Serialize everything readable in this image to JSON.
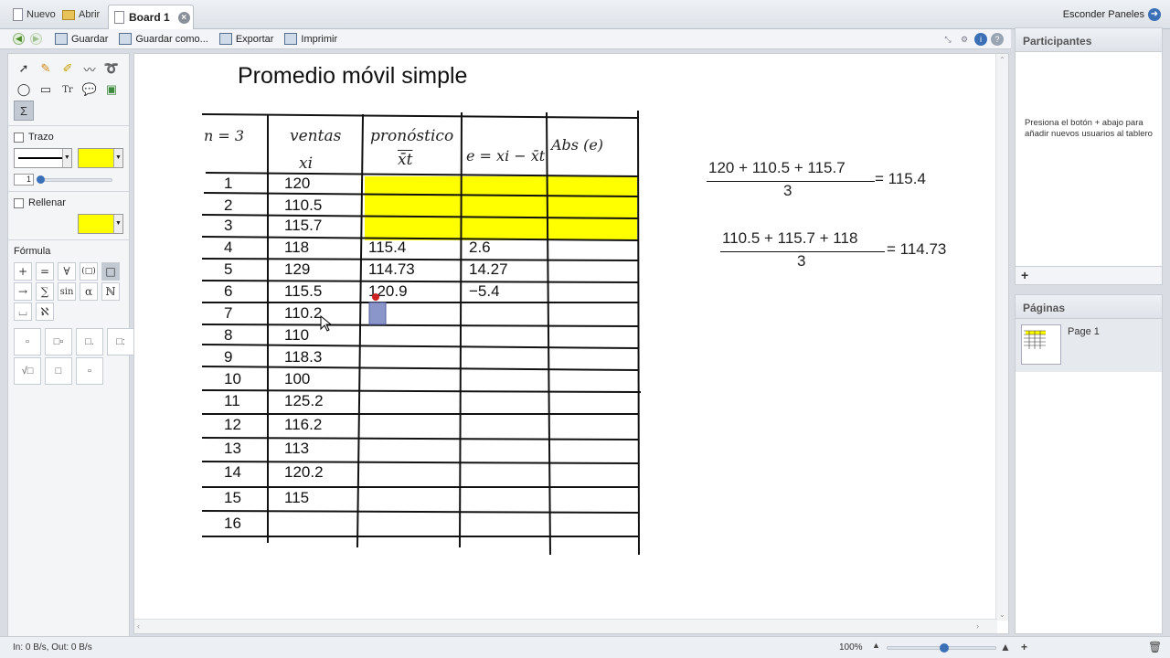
{
  "tabbar": {
    "new_label": "Nuevo",
    "open_label": "Abrir",
    "active_tab": "Board 1",
    "hide_panels": "Esconder Paneles"
  },
  "toolbar": {
    "save": "Guardar",
    "save_as": "Guardar como...",
    "export": "Exportar",
    "print": "Imprimir"
  },
  "left_panel": {
    "stroke_label": "Trazo",
    "stroke_width": "1",
    "stroke_color": "#ffff00",
    "fill_label": "Rellenar",
    "fill_color": "#ffff00",
    "formula_label": "Fórmula",
    "formula_buttons": [
      "+",
      "=",
      "∀",
      "(□)",
      "□",
      "→",
      "∑",
      "sin",
      "α",
      "ℕ",
      "⌴",
      "ℵ"
    ]
  },
  "canvas": {
    "title": "Promedio móvil simple",
    "headers": {
      "n": "n = 3",
      "sales_1": "ventas",
      "sales_2": "xi",
      "forecast_1": "pronóstico",
      "forecast_2": "x̄t",
      "error": "e = xi − x̄t",
      "abs": "Abs (e)"
    },
    "rows": [
      {
        "n": "1",
        "ventas": "120",
        "pronostico": "",
        "error": ""
      },
      {
        "n": "2",
        "ventas": "110.5",
        "pronostico": "",
        "error": ""
      },
      {
        "n": "3",
        "ventas": "115.7",
        "pronostico": "",
        "error": ""
      },
      {
        "n": "4",
        "ventas": "118",
        "pronostico": "115.4",
        "error": "2.6"
      },
      {
        "n": "5",
        "ventas": "129",
        "pronostico": "114.73",
        "error": "14.27"
      },
      {
        "n": "6",
        "ventas": "115.5",
        "pronostico": "120.9",
        "error": "−5.4"
      },
      {
        "n": "7",
        "ventas": "110.2",
        "pronostico": "",
        "error": ""
      },
      {
        "n": "8",
        "ventas": "110",
        "pronostico": "",
        "error": ""
      },
      {
        "n": "9",
        "ventas": "118.3",
        "pronostico": "",
        "error": ""
      },
      {
        "n": "10",
        "ventas": "100",
        "pronostico": "",
        "error": ""
      },
      {
        "n": "11",
        "ventas": "125.2",
        "pronostico": "",
        "error": ""
      },
      {
        "n": "12",
        "ventas": "116.2",
        "pronostico": "",
        "error": ""
      },
      {
        "n": "13",
        "ventas": "113",
        "pronostico": "",
        "error": ""
      },
      {
        "n": "14",
        "ventas": "120.2",
        "pronostico": "",
        "error": ""
      },
      {
        "n": "15",
        "ventas": "115",
        "pronostico": "",
        "error": ""
      },
      {
        "n": "16",
        "ventas": "",
        "pronostico": "",
        "error": ""
      }
    ],
    "equation1": {
      "numerator": "120 + 110.5 + 115.7",
      "denominator": "3",
      "result": "= 115.4"
    },
    "equation2": {
      "numerator": "110.5 + 115.7 + 118",
      "denominator": "3",
      "result": "= 114.73"
    },
    "highlight_color": "#ffff00"
  },
  "participants": {
    "title": "Participantes",
    "hint": "Presiona el botón + abajo para añadir nuevos usuarios al tablero"
  },
  "pages": {
    "title": "Páginas",
    "items": [
      "Page 1"
    ]
  },
  "statusbar": {
    "io": "In: 0 B/s, Out: 0 B/s",
    "zoom": "100%"
  }
}
